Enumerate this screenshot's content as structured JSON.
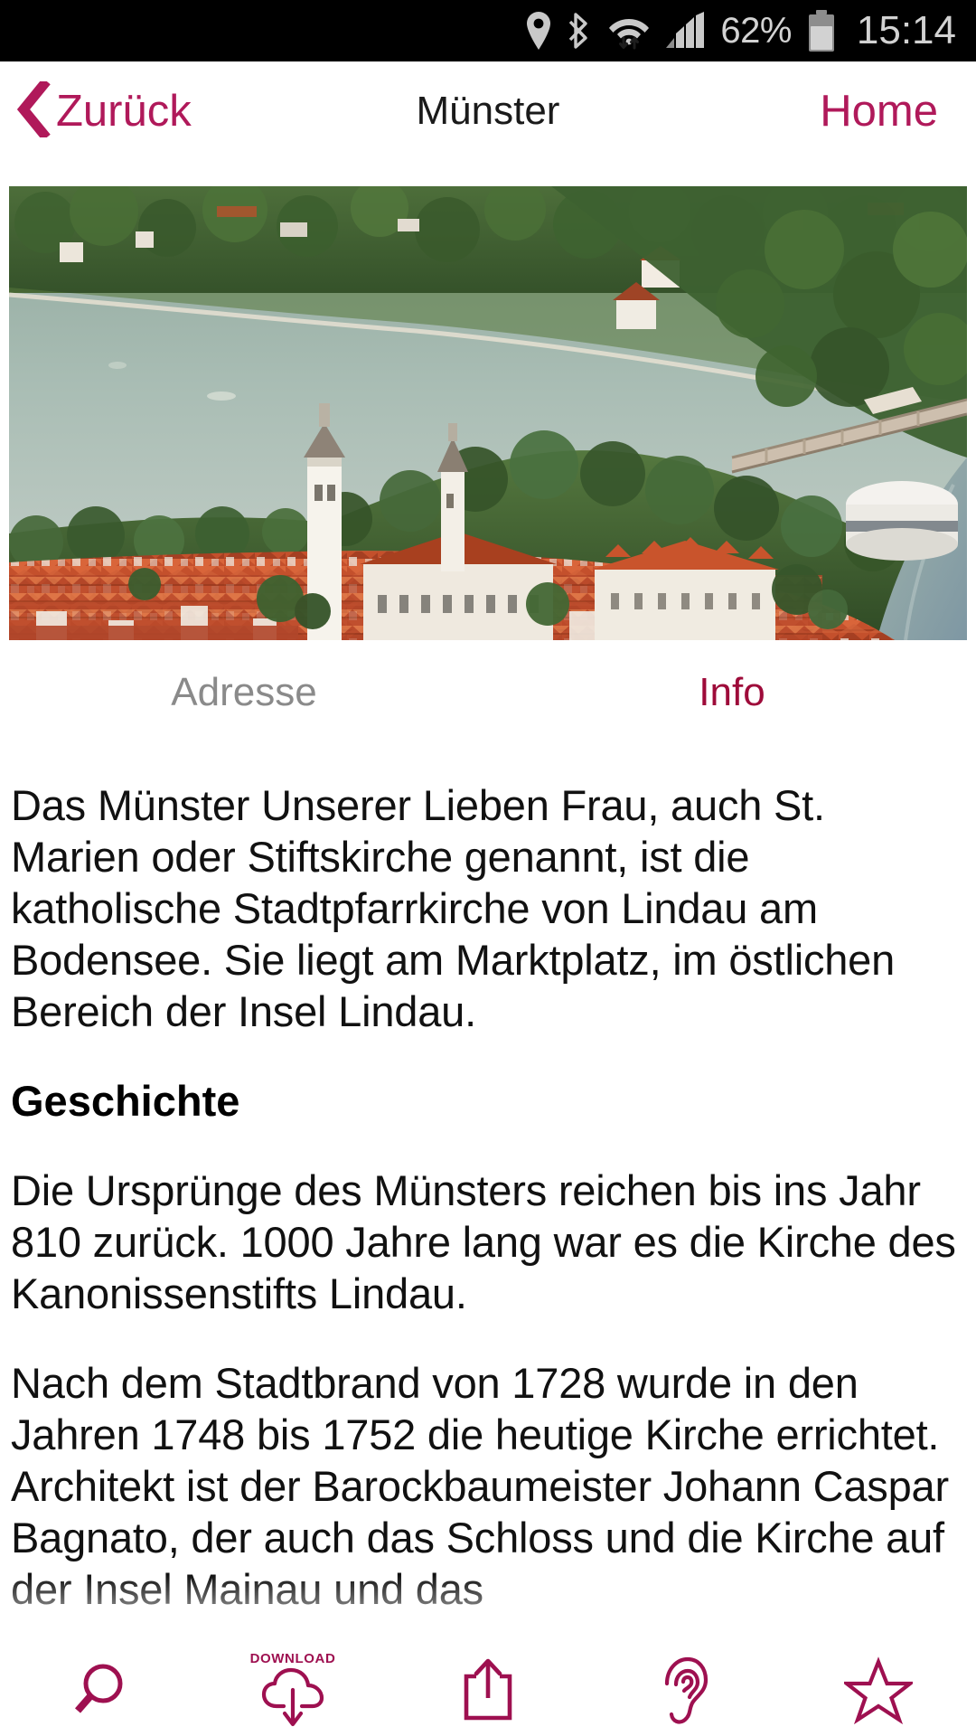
{
  "statusbar": {
    "icons": [
      "location-pin-icon",
      "bluetooth-icon",
      "wifi-icon",
      "signal-bars-icon"
    ],
    "battery_percent": "62%",
    "battery_icon": "battery-icon",
    "clock": "15:14",
    "text_color": "#d2d2d2",
    "background": "#000000"
  },
  "navbar": {
    "back_label": "Zurück",
    "back_icon": "chevron-left-icon",
    "title": "Münster",
    "home_label": "Home",
    "accent_color": "#b0195a"
  },
  "hero": {
    "alt": "Luftbild der Insel Lindau am Bodensee mit Münster"
  },
  "tabs": [
    {
      "label": "Adresse",
      "active": false
    },
    {
      "label": "Info",
      "active": true
    }
  ],
  "article": {
    "blocks": [
      {
        "type": "paragraph",
        "text": "Das Münster Unserer Lieben Frau, auch St. Marien oder Stiftskirche genannt, ist die katholische Stadtpfarrkirche von Lindau am Bodensee. Sie liegt am Marktplatz, im östlichen Bereich der Insel Lindau."
      },
      {
        "type": "heading",
        "text": "Geschichte"
      },
      {
        "type": "paragraph",
        "text": "Die Ursprünge des Münsters reichen bis ins Jahr 810 zurück. 1000 Jahre lang war es die Kirche des Kanonissenstifts Lindau."
      },
      {
        "type": "paragraph",
        "text": "Nach dem Stadtbrand von 1728 wurde in den Jahren 1748 bis 1752 die heutige Kirche errichtet. Architekt ist der Barockbaumeister Johann Caspar Bagnato, der auch das Schloss und die Kirche auf der Insel Mainau und das"
      }
    ]
  },
  "toolbar": {
    "accent_color": "#9e1050",
    "buttons": [
      {
        "name": "search-icon",
        "label": ""
      },
      {
        "name": "cloud-download-icon",
        "label": "DOWNLOAD"
      },
      {
        "name": "share-icon",
        "label": ""
      },
      {
        "name": "ear-listen-icon",
        "label": ""
      },
      {
        "name": "star-favorite-icon",
        "label": ""
      }
    ]
  }
}
